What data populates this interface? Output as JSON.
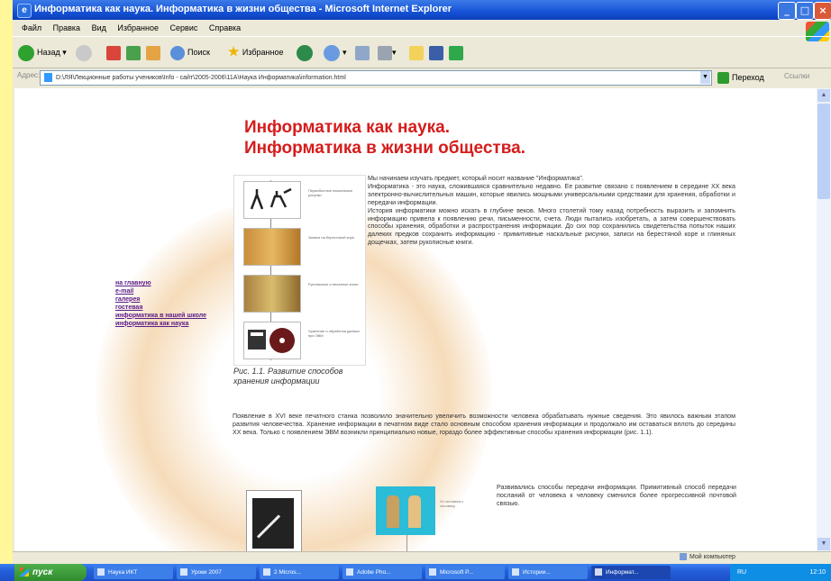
{
  "window": {
    "title": "Информатика как наука. Информатика в жизни общества - Microsoft Internet Explorer",
    "controls": {
      "minimize": "_",
      "maximize": "□",
      "close": "×"
    }
  },
  "menu": [
    "Файл",
    "Правка",
    "Вид",
    "Избранное",
    "Сервис",
    "Справка"
  ],
  "toolbar": {
    "back": "Назад",
    "search": "Поиск",
    "favorites": "Избранное"
  },
  "address": {
    "label": "Адрес:",
    "value": "D:\\ЛЯ\\Лекционные работы учеников\\Info - сайт\\2005-2006\\11А\\Наука Информатика\\information.html",
    "go": "Переход",
    "links": "Ссылки"
  },
  "page": {
    "title_line1": "Информатика как наука.",
    "title_line2": "Информатика в жизни общества.",
    "nav_links": [
      "на главную",
      "e-mail",
      "галерея",
      "гостевая",
      "информатика в нашей школе",
      "информатика как наука"
    ],
    "figure_captions": [
      "Первобытные наскальные рисунки",
      "Записи на берестяной коре",
      "Рукописные и печатные книги",
      "Хранение и обработка данных при ЭВМ"
    ],
    "figure1_caption": "Рис. 1.1. Развитие способов хранения информации",
    "paragraphs": [
      "Мы начинаем изучать предмет, который носит название \"Информатика\".",
      "Информатика - это наука, сложившаяся сравнительно недавно. Ее развитие связано с появлением в середине XX века электронно-вычислительных машин, которые явились мощными универсальными средствами для хранения, обработки и передачи информации.",
      "История информатики можно искать в глубине веков. Много столетий тому назад потребность выразить и запомнить информацию привела к появлению речи, письменности, счета. Люди пытались изобретать, а затем совершенствовать способы хранения, обработки и распространения информации. До сих пор сохранились свидетельства попыток наших далеких предков сохранить информацию - примитивные наскальные рисунки, записи на берестяной коре и глиняных дощечках, затем рукописные книги.",
      "Появление в XVI веке печатного станка позволило значительно увеличить возможности человека обрабатывать нужные сведения. Это явилось важным этапом развития человечества. Хранение информации в печатном виде стало основным способом хранения информации и продолжало им оставаться вплоть до середины XX века. Только с появлением ЭВМ возникли принципиально новые, гораздо более эффективные способы хранения информации (рис. 1.1)."
    ],
    "figure3_caption": "От человека к человеку",
    "paragraph_last": "Развивались способы передачи информации. Примитивный способ передачи посланий от человека к человеку сменился более прогрессивной почтовой связью."
  },
  "status": {
    "left": "",
    "zone": "Мой компьютер"
  },
  "taskbar": {
    "start": "пуск",
    "buttons": [
      "Наука ИКТ",
      "Уроки 2007",
      "2 Micros...",
      "Adobe Pho...",
      "Microsoft P...",
      "Истории...",
      "Информат..."
    ],
    "tray_lang": "RU",
    "clock": "12:10"
  },
  "colors": {
    "accent_title": "#d51c1c",
    "link": "#5a1b88",
    "titlebar": "#1652d6",
    "outer_bg": "#fff799"
  }
}
